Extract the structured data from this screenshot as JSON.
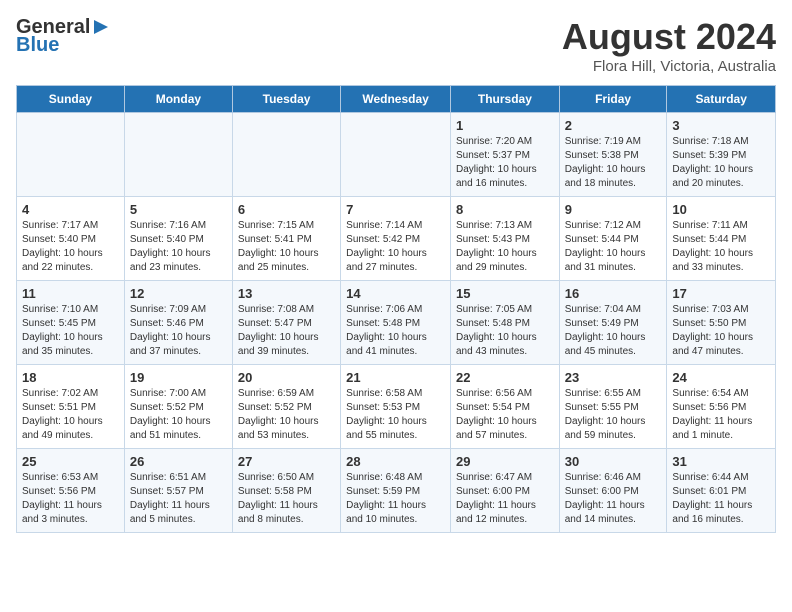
{
  "header": {
    "logo_line1": "General",
    "logo_line2": "Blue",
    "title": "August 2024",
    "subtitle": "Flora Hill, Victoria, Australia"
  },
  "weekdays": [
    "Sunday",
    "Monday",
    "Tuesday",
    "Wednesday",
    "Thursday",
    "Friday",
    "Saturday"
  ],
  "weeks": [
    [
      {
        "day": "",
        "detail": ""
      },
      {
        "day": "",
        "detail": ""
      },
      {
        "day": "",
        "detail": ""
      },
      {
        "day": "",
        "detail": ""
      },
      {
        "day": "1",
        "detail": "Sunrise: 7:20 AM\nSunset: 5:37 PM\nDaylight: 10 hours\nand 16 minutes."
      },
      {
        "day": "2",
        "detail": "Sunrise: 7:19 AM\nSunset: 5:38 PM\nDaylight: 10 hours\nand 18 minutes."
      },
      {
        "day": "3",
        "detail": "Sunrise: 7:18 AM\nSunset: 5:39 PM\nDaylight: 10 hours\nand 20 minutes."
      }
    ],
    [
      {
        "day": "4",
        "detail": "Sunrise: 7:17 AM\nSunset: 5:40 PM\nDaylight: 10 hours\nand 22 minutes."
      },
      {
        "day": "5",
        "detail": "Sunrise: 7:16 AM\nSunset: 5:40 PM\nDaylight: 10 hours\nand 23 minutes."
      },
      {
        "day": "6",
        "detail": "Sunrise: 7:15 AM\nSunset: 5:41 PM\nDaylight: 10 hours\nand 25 minutes."
      },
      {
        "day": "7",
        "detail": "Sunrise: 7:14 AM\nSunset: 5:42 PM\nDaylight: 10 hours\nand 27 minutes."
      },
      {
        "day": "8",
        "detail": "Sunrise: 7:13 AM\nSunset: 5:43 PM\nDaylight: 10 hours\nand 29 minutes."
      },
      {
        "day": "9",
        "detail": "Sunrise: 7:12 AM\nSunset: 5:44 PM\nDaylight: 10 hours\nand 31 minutes."
      },
      {
        "day": "10",
        "detail": "Sunrise: 7:11 AM\nSunset: 5:44 PM\nDaylight: 10 hours\nand 33 minutes."
      }
    ],
    [
      {
        "day": "11",
        "detail": "Sunrise: 7:10 AM\nSunset: 5:45 PM\nDaylight: 10 hours\nand 35 minutes."
      },
      {
        "day": "12",
        "detail": "Sunrise: 7:09 AM\nSunset: 5:46 PM\nDaylight: 10 hours\nand 37 minutes."
      },
      {
        "day": "13",
        "detail": "Sunrise: 7:08 AM\nSunset: 5:47 PM\nDaylight: 10 hours\nand 39 minutes."
      },
      {
        "day": "14",
        "detail": "Sunrise: 7:06 AM\nSunset: 5:48 PM\nDaylight: 10 hours\nand 41 minutes."
      },
      {
        "day": "15",
        "detail": "Sunrise: 7:05 AM\nSunset: 5:48 PM\nDaylight: 10 hours\nand 43 minutes."
      },
      {
        "day": "16",
        "detail": "Sunrise: 7:04 AM\nSunset: 5:49 PM\nDaylight: 10 hours\nand 45 minutes."
      },
      {
        "day": "17",
        "detail": "Sunrise: 7:03 AM\nSunset: 5:50 PM\nDaylight: 10 hours\nand 47 minutes."
      }
    ],
    [
      {
        "day": "18",
        "detail": "Sunrise: 7:02 AM\nSunset: 5:51 PM\nDaylight: 10 hours\nand 49 minutes."
      },
      {
        "day": "19",
        "detail": "Sunrise: 7:00 AM\nSunset: 5:52 PM\nDaylight: 10 hours\nand 51 minutes."
      },
      {
        "day": "20",
        "detail": "Sunrise: 6:59 AM\nSunset: 5:52 PM\nDaylight: 10 hours\nand 53 minutes."
      },
      {
        "day": "21",
        "detail": "Sunrise: 6:58 AM\nSunset: 5:53 PM\nDaylight: 10 hours\nand 55 minutes."
      },
      {
        "day": "22",
        "detail": "Sunrise: 6:56 AM\nSunset: 5:54 PM\nDaylight: 10 hours\nand 57 minutes."
      },
      {
        "day": "23",
        "detail": "Sunrise: 6:55 AM\nSunset: 5:55 PM\nDaylight: 10 hours\nand 59 minutes."
      },
      {
        "day": "24",
        "detail": "Sunrise: 6:54 AM\nSunset: 5:56 PM\nDaylight: 11 hours\nand 1 minute."
      }
    ],
    [
      {
        "day": "25",
        "detail": "Sunrise: 6:53 AM\nSunset: 5:56 PM\nDaylight: 11 hours\nand 3 minutes."
      },
      {
        "day": "26",
        "detail": "Sunrise: 6:51 AM\nSunset: 5:57 PM\nDaylight: 11 hours\nand 5 minutes."
      },
      {
        "day": "27",
        "detail": "Sunrise: 6:50 AM\nSunset: 5:58 PM\nDaylight: 11 hours\nand 8 minutes."
      },
      {
        "day": "28",
        "detail": "Sunrise: 6:48 AM\nSunset: 5:59 PM\nDaylight: 11 hours\nand 10 minutes."
      },
      {
        "day": "29",
        "detail": "Sunrise: 6:47 AM\nSunset: 6:00 PM\nDaylight: 11 hours\nand 12 minutes."
      },
      {
        "day": "30",
        "detail": "Sunrise: 6:46 AM\nSunset: 6:00 PM\nDaylight: 11 hours\nand 14 minutes."
      },
      {
        "day": "31",
        "detail": "Sunrise: 6:44 AM\nSunset: 6:01 PM\nDaylight: 11 hours\nand 16 minutes."
      }
    ]
  ]
}
